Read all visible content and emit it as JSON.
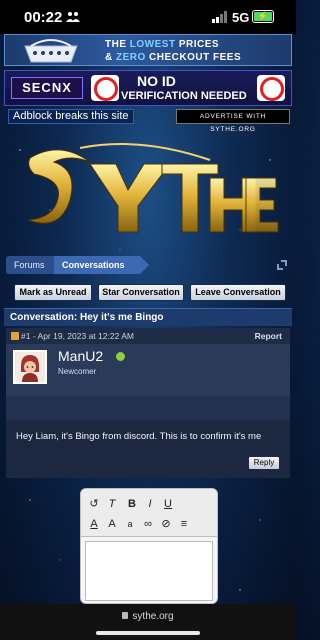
{
  "status_bar": {
    "time": "00:22",
    "network": "5G",
    "battery": ""
  },
  "ads": {
    "top": {
      "line1_pre": "THE ",
      "line1_hl": "LOWEST",
      "line1_post": " PRICES",
      "line2_pre": "& ",
      "line2_hl": "ZERO",
      "line2_post": " CHECKOUT FEES"
    },
    "second": {
      "brand": "SECNX",
      "title": "NO ID",
      "subtitle": "VERIFICATION NEEDED"
    }
  },
  "notices": {
    "adblock": "Adblock breaks this site",
    "advertise": "ADVERTISE WITH SYTHE.ORG"
  },
  "breadcrumb": {
    "forums": "Forums",
    "conversations": "Conversations"
  },
  "actions": {
    "mark_unread": "Mark as Unread",
    "star": "Star Conversation",
    "leave": "Leave Conversation"
  },
  "conversation": {
    "title": "Conversation: Hey it's me Bingo"
  },
  "message": {
    "id_date": "#1 - Apr 19, 2023 at 12:22 AM",
    "report": "Report",
    "username": "ManU2",
    "role": "Newcomer",
    "text": "Hey Liam, it's Bingo from discord. This is to confirm it's me",
    "reply": "Reply"
  },
  "footer": {
    "url": "sythe.org"
  },
  "colors": {
    "accent": "#3d69b4",
    "online": "#8cd03b",
    "header": "#1d3b6c"
  }
}
